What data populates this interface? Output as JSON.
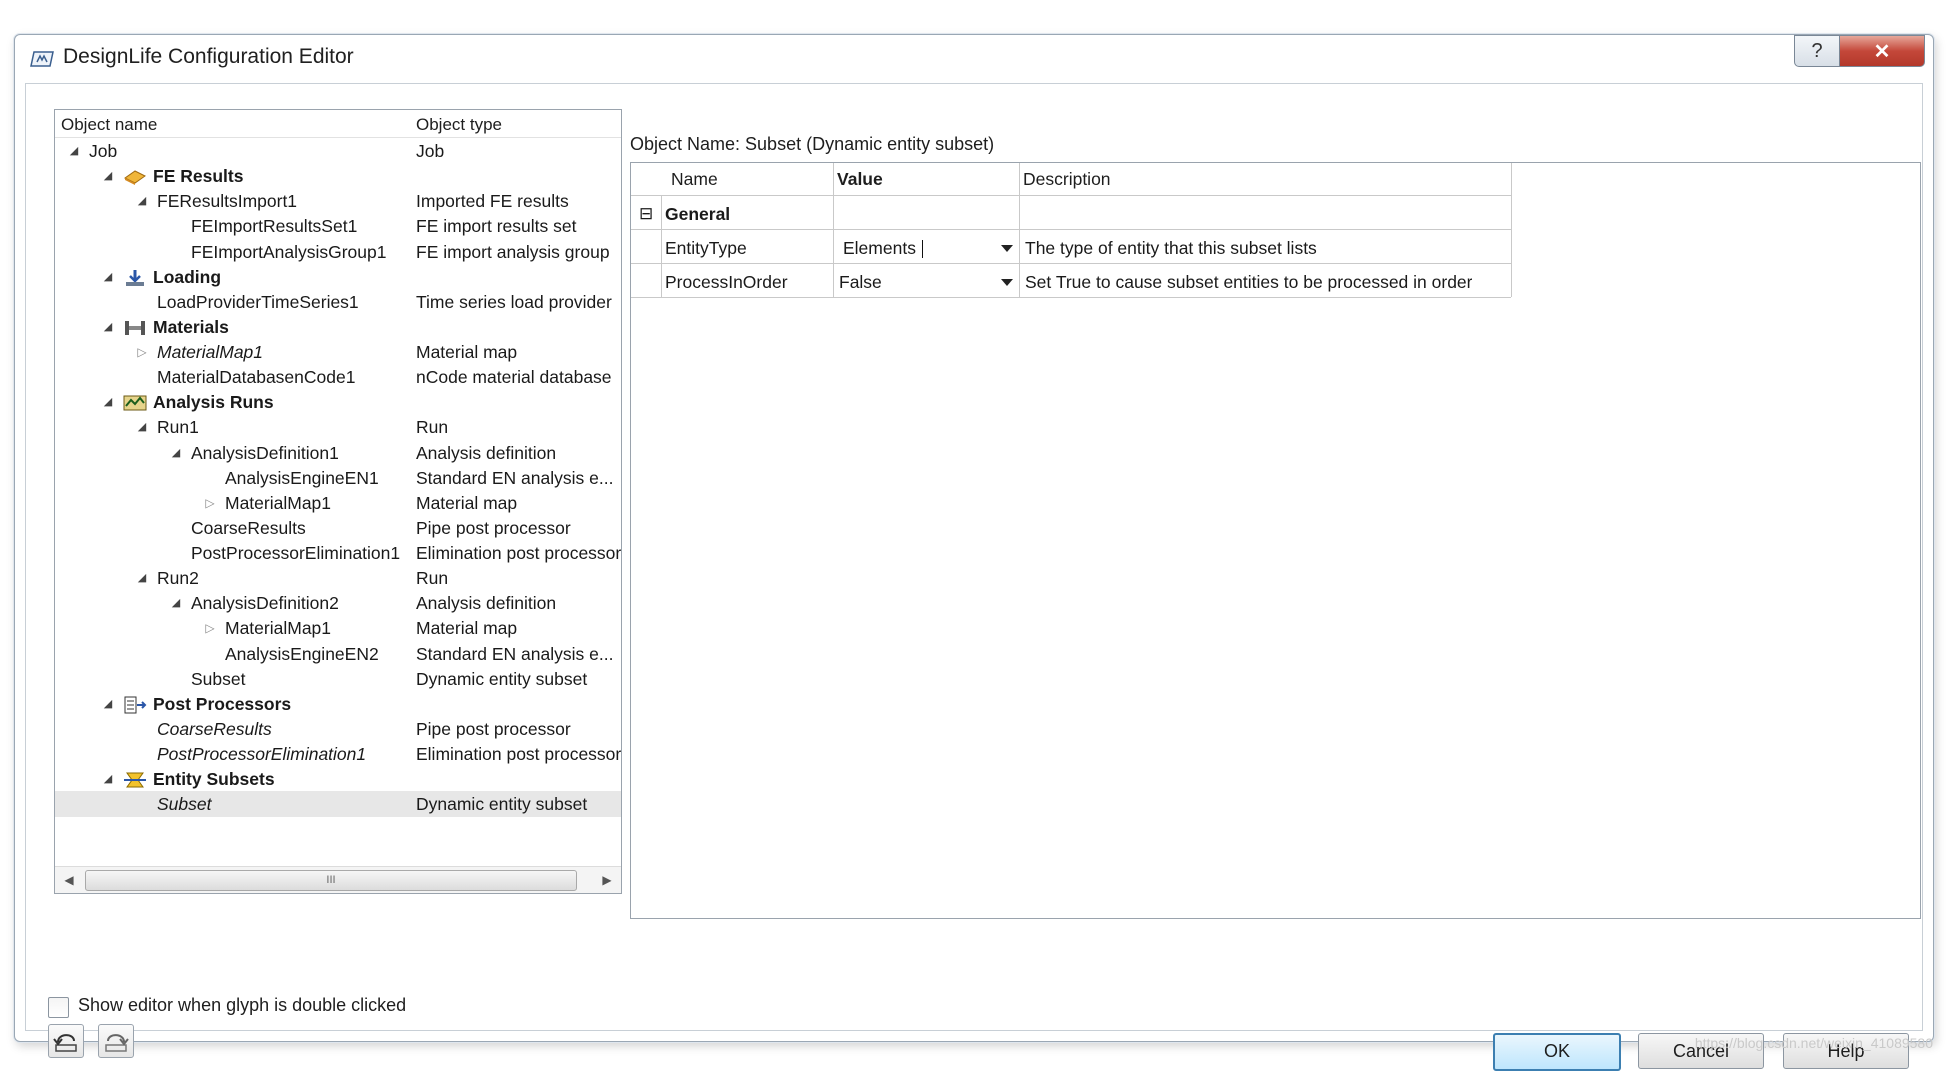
{
  "window": {
    "title": "DesignLife Configuration Editor",
    "help_label": "?",
    "close_label": "✕"
  },
  "tree": {
    "col_name": "Object name",
    "col_type": "Object type",
    "rows": [
      {
        "name": "Job",
        "type": "Job",
        "level": 0,
        "arrow": "open",
        "style": "normal",
        "icon": ""
      },
      {
        "name": "FE Results",
        "type": "",
        "level": 1,
        "arrow": "open",
        "style": "bold",
        "icon": "fe-results-icon"
      },
      {
        "name": "FEResultsImport1",
        "type": "Imported FE results",
        "level": 2,
        "arrow": "open",
        "style": "normal",
        "icon": ""
      },
      {
        "name": "FEImportResultsSet1",
        "type": "FE import results set",
        "level": 3,
        "arrow": "none",
        "style": "normal",
        "icon": ""
      },
      {
        "name": "FEImportAnalysisGroup1",
        "type": "FE import analysis group",
        "level": 3,
        "arrow": "none",
        "style": "normal",
        "icon": ""
      },
      {
        "name": "Loading",
        "type": "",
        "level": 1,
        "arrow": "open",
        "style": "bold",
        "icon": "loading-icon"
      },
      {
        "name": "LoadProviderTimeSeries1",
        "type": "Time series load provider",
        "level": 2,
        "arrow": "none",
        "style": "normal",
        "icon": ""
      },
      {
        "name": "Materials",
        "type": "",
        "level": 1,
        "arrow": "open",
        "style": "bold",
        "icon": "materials-icon"
      },
      {
        "name": "MaterialMap1",
        "type": "Material map",
        "level": 2,
        "arrow": "closed",
        "style": "italic",
        "icon": ""
      },
      {
        "name": "MaterialDatabasenCode1",
        "type": "nCode material database",
        "level": 2,
        "arrow": "none",
        "style": "normal",
        "icon": ""
      },
      {
        "name": "Analysis Runs",
        "type": "",
        "level": 1,
        "arrow": "open",
        "style": "bold",
        "icon": "analysis-runs-icon"
      },
      {
        "name": "Run1",
        "type": "Run",
        "level": 2,
        "arrow": "open",
        "style": "normal",
        "icon": ""
      },
      {
        "name": "AnalysisDefinition1",
        "type": "Analysis definition",
        "level": 3,
        "arrow": "open",
        "style": "normal",
        "icon": ""
      },
      {
        "name": "AnalysisEngineEN1",
        "type": "Standard EN analysis e...",
        "level": 4,
        "arrow": "none",
        "style": "normal",
        "icon": ""
      },
      {
        "name": "MaterialMap1",
        "type": "Material map",
        "level": 4,
        "arrow": "closed",
        "style": "normal",
        "icon": ""
      },
      {
        "name": "CoarseResults",
        "type": "Pipe post processor",
        "level": 3,
        "arrow": "none",
        "style": "normal",
        "icon": ""
      },
      {
        "name": "PostProcessorElimination1",
        "type": "Elimination post processor",
        "level": 3,
        "arrow": "none",
        "style": "normal",
        "icon": ""
      },
      {
        "name": "Run2",
        "type": "Run",
        "level": 2,
        "arrow": "open",
        "style": "normal",
        "icon": ""
      },
      {
        "name": "AnalysisDefinition2",
        "type": "Analysis definition",
        "level": 3,
        "arrow": "open",
        "style": "normal",
        "icon": ""
      },
      {
        "name": "MaterialMap1",
        "type": "Material map",
        "level": 4,
        "arrow": "closed",
        "style": "normal",
        "icon": ""
      },
      {
        "name": "AnalysisEngineEN2",
        "type": "Standard EN analysis e...",
        "level": 4,
        "arrow": "none",
        "style": "normal",
        "icon": ""
      },
      {
        "name": "Subset",
        "type": "Dynamic entity subset",
        "level": 3,
        "arrow": "none",
        "style": "normal",
        "icon": ""
      },
      {
        "name": "Post Processors",
        "type": "",
        "level": 1,
        "arrow": "open",
        "style": "bold",
        "icon": "post-processors-icon"
      },
      {
        "name": "CoarseResults",
        "type": "Pipe post processor",
        "level": 2,
        "arrow": "none",
        "style": "italic",
        "icon": ""
      },
      {
        "name": "PostProcessorElimination1",
        "type": "Elimination post processor",
        "level": 2,
        "arrow": "none",
        "style": "italic",
        "icon": ""
      },
      {
        "name": "Entity Subsets",
        "type": "",
        "level": 1,
        "arrow": "open",
        "style": "bold",
        "icon": "entity-subsets-icon"
      },
      {
        "name": "Subset",
        "type": "Dynamic entity subset",
        "level": 2,
        "arrow": "none",
        "style": "italic",
        "icon": "",
        "selected": true
      }
    ],
    "scroll_thumb_label": "III"
  },
  "properties": {
    "object_label": "Object Name: Subset (Dynamic entity subset)",
    "col_name": "Name",
    "col_value": "Value",
    "col_description": "Description",
    "category": {
      "expander": "⊟",
      "label": "General"
    },
    "rows": [
      {
        "name": "EntityType",
        "value": "Elements",
        "description": "The type of entity that this subset lists"
      },
      {
        "name": "ProcessInOrder",
        "value": "False",
        "description": "Set True to cause subset entities to be processed in order"
      }
    ]
  },
  "footer": {
    "checkbox_label": "Show editor when glyph is double clicked",
    "checkbox_checked": false,
    "ok_label": "OK",
    "cancel_label": "Cancel",
    "help_label": "Help"
  },
  "watermark": "https://blog.csdn.net/weixin_41089580"
}
